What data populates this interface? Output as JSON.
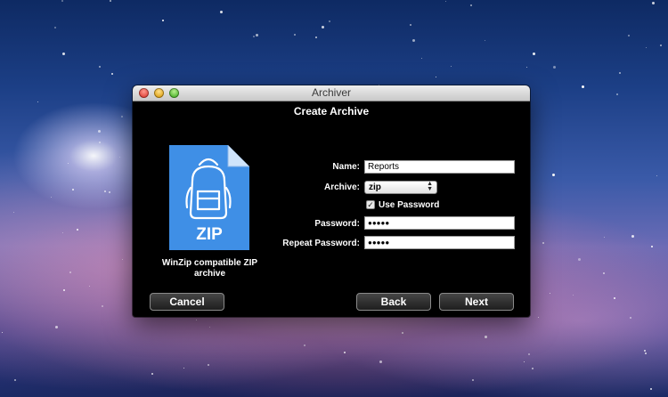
{
  "window": {
    "title": "Archiver",
    "heading": "Create Archive"
  },
  "format": {
    "icon_text": "ZIP",
    "caption": "WinZip compatible ZIP archive"
  },
  "form": {
    "name_label": "Name:",
    "name_value": "Reports",
    "archive_label": "Archive:",
    "archive_value": "zip",
    "use_password_label": "Use Password",
    "use_password_checked": true,
    "password_label": "Password:",
    "password_value": "●●●●●",
    "repeat_password_label": "Repeat Password:",
    "repeat_password_value": "●●●●●"
  },
  "buttons": {
    "cancel": "Cancel",
    "back": "Back",
    "next": "Next"
  },
  "colors": {
    "zip_blue": "#3f8fe6",
    "window_bg": "#000000"
  }
}
